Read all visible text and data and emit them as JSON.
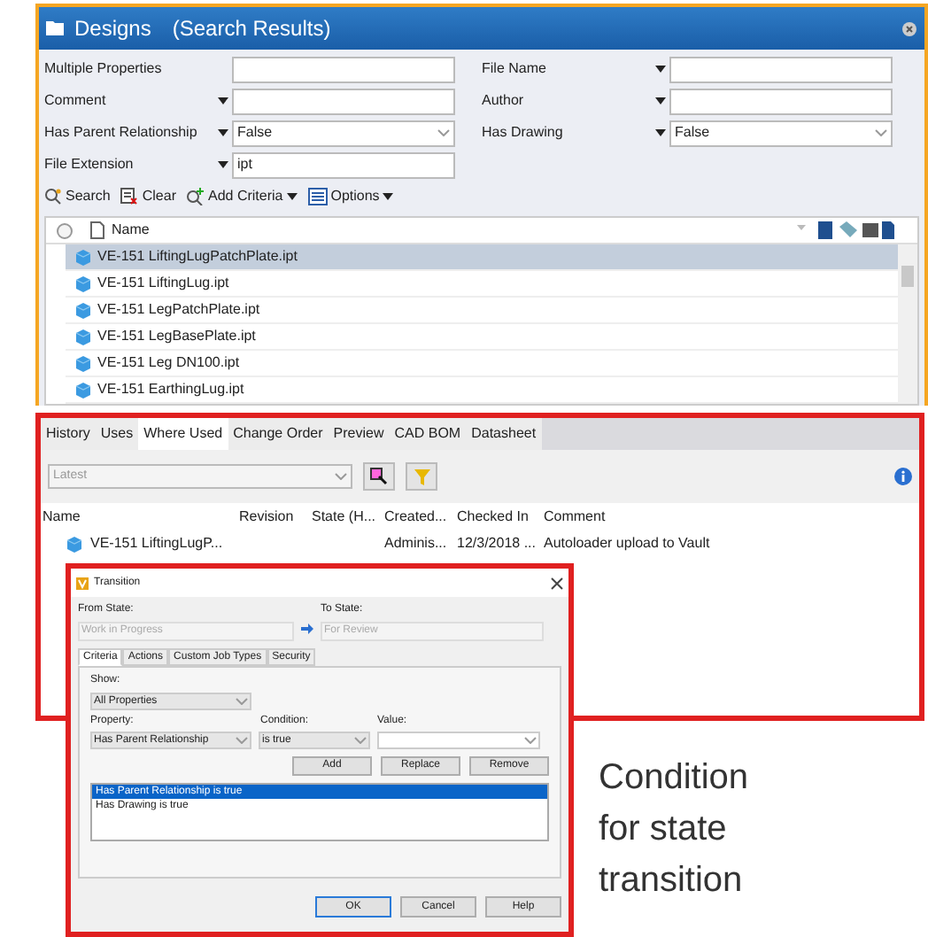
{
  "window": {
    "title": "Designs",
    "subtitle": "(Search Results)"
  },
  "search_rows": [
    {
      "fields": [
        {
          "label": "Multiple Properties",
          "has_menu": false,
          "kind": "text"
        },
        {
          "label": "File Name",
          "has_menu": true,
          "kind": "text"
        }
      ]
    },
    {
      "fields": [
        {
          "label": "Comment",
          "has_menu": true,
          "kind": "text"
        },
        {
          "label": "Author",
          "has_menu": true,
          "kind": "text"
        }
      ]
    },
    {
      "fields": [
        {
          "label": "Has Parent Relationship",
          "has_menu": true,
          "kind": "select",
          "value": "False"
        },
        {
          "label": "Has Drawing",
          "has_menu": true,
          "kind": "select",
          "value": "False"
        }
      ]
    },
    {
      "fields": [
        {
          "label": "File Extension",
          "has_menu": true,
          "kind": "text",
          "value": "ipt"
        }
      ]
    }
  ],
  "toolbar": [
    {
      "label": "Search",
      "kind": "search",
      "has_menu": false
    },
    {
      "label": "Clear",
      "kind": "clear",
      "has_menu": false
    },
    {
      "label": "Add Criteria",
      "kind": "add",
      "has_menu": true
    },
    {
      "label": "Options",
      "kind": "options",
      "has_menu": true
    }
  ],
  "results": {
    "name_column": "Name",
    "rows": [
      {
        "name": "VE-151 LiftingLugPatchPlate.ipt",
        "selected": true
      },
      {
        "name": "VE-151 LiftingLug.ipt",
        "selected": false
      },
      {
        "name": "VE-151 LegPatchPlate.ipt",
        "selected": false
      },
      {
        "name": "VE-151 LegBasePlate.ipt",
        "selected": false
      },
      {
        "name": "VE-151 Leg DN100.ipt",
        "selected": false
      },
      {
        "name": "VE-151 EarthingLug.ipt",
        "selected": false
      }
    ]
  },
  "tabs": [
    {
      "label": "History",
      "selected": false
    },
    {
      "label": "Uses",
      "selected": false
    },
    {
      "label": "Where Used",
      "selected": true
    },
    {
      "label": "Change Order",
      "selected": false
    },
    {
      "label": "Preview",
      "selected": false
    },
    {
      "label": "CAD BOM",
      "selected": false
    },
    {
      "label": "Datasheet",
      "selected": false
    }
  ],
  "where_used": {
    "version": "Latest",
    "columns": [
      "Name",
      "Revision",
      "State (H...",
      "Created...",
      "Checked In",
      "Comment"
    ],
    "rows": [
      {
        "cells": [
          "VE-151 LiftingLugP...",
          "",
          "",
          "Adminis...",
          "12/3/2018 ...",
          "Autoloader upload to Vault"
        ]
      }
    ]
  },
  "dialog": {
    "title": "Transition",
    "from_label": "From State:",
    "from_value": "Work in Progress",
    "to_label": "To State:",
    "to_value": "For Review",
    "tabs": [
      {
        "label": "Criteria",
        "selected": true
      },
      {
        "label": "Actions",
        "selected": false
      },
      {
        "label": "Custom Job Types",
        "selected": false
      },
      {
        "label": "Security",
        "selected": false
      }
    ],
    "show_label": "Show:",
    "show_value": "All Properties",
    "property_label": "Property:",
    "property_value": "Has Parent Relationship",
    "condition_label": "Condition:",
    "condition_value": "is true",
    "value_label": "Value:",
    "actions": [
      "Add",
      "Replace",
      "Remove"
    ],
    "conditions": [
      {
        "text": "Has Parent Relationship is true",
        "selected": true
      },
      {
        "text": "Has Drawing is true",
        "selected": false
      }
    ],
    "buttons": [
      {
        "label": "OK",
        "default": true
      },
      {
        "label": "Cancel",
        "default": false
      },
      {
        "label": "Help",
        "default": false
      }
    ]
  },
  "callout": "Condition for state transition"
}
